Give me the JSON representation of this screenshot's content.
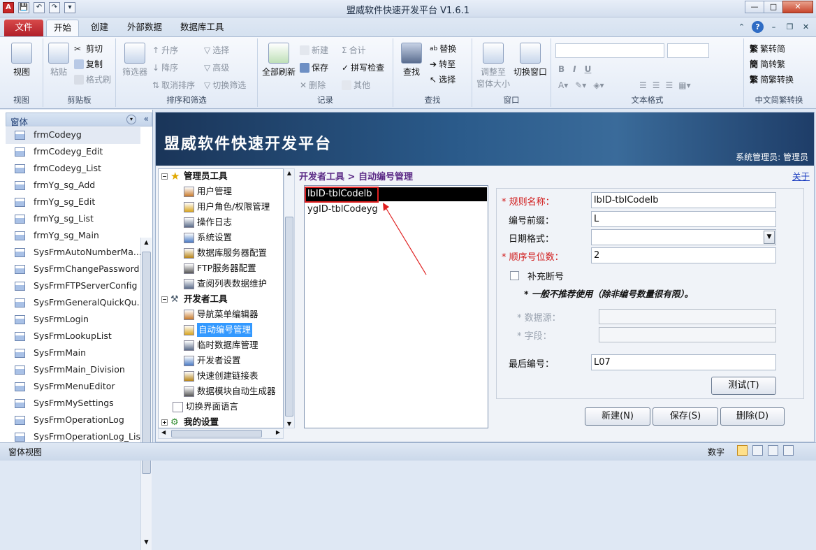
{
  "window": {
    "title": "盟威软件快速开发平台 V1.6.1",
    "app_icon": "A"
  },
  "qat": {
    "save_icon": "💾",
    "undo_icon": "↶",
    "redo_icon": "↷",
    "more_icon": "▾"
  },
  "tabs": [
    "文件",
    "开始",
    "创建",
    "外部数据",
    "数据库工具"
  ],
  "ribbon": {
    "view": {
      "view": "视图",
      "group": "视图"
    },
    "clipboard": {
      "paste": "粘贴",
      "cut": "剪切",
      "copy": "复制",
      "format_painter": "格式刷",
      "group": "剪贴板"
    },
    "sort": {
      "filter": "筛选器",
      "asc": "升序",
      "desc": "降序",
      "clear_sort": "取消排序",
      "select": "选择",
      "advanced": "高级",
      "toggle_filter": "切换筛选",
      "group": "排序和筛选"
    },
    "records": {
      "refresh_all": "全部刷新",
      "new": "新建",
      "save": "保存",
      "delete": "删除",
      "totals": "合计",
      "spelling": "拼写检查",
      "more": "其他",
      "group": "记录"
    },
    "find": {
      "find": "查找",
      "replace": "替换",
      "goto": "转至",
      "select": "选择",
      "group": "查找"
    },
    "window": {
      "size_to_fit": "调整至",
      "size_to_fit2": "窗体大小",
      "switch_windows": "切换窗口",
      "group": "窗口"
    },
    "text_format": {
      "bold": "B",
      "italic": "I",
      "underline": "U",
      "group": "文本格式"
    },
    "convert": {
      "t2s": "繁转简",
      "s2t": "简转繁",
      "s2t_alt": "简繁转换",
      "group": "中文简繁转换"
    }
  },
  "nav": {
    "header": "窗体",
    "items": [
      "frmCodeyg",
      "frmCodeyg_Edit",
      "frmCodeyg_List",
      "frmYg_sg_Add",
      "frmYg_sg_Edit",
      "frmYg_sg_List",
      "frmYg_sg_Main",
      "SysFrmAutoNumberMa...",
      "SysFrmChangePassword",
      "SysFrmFTPServerConfig",
      "SysFrmGeneralQuickQu...",
      "SysFrmLogin",
      "SysFrmLookupList",
      "SysFrmMain",
      "SysFrmMain_Division",
      "SysFrmMenuEditor",
      "SysFrmMySettings",
      "SysFrmOperationLog",
      "SysFrmOperationLog_List"
    ]
  },
  "banner": {
    "title": "盟威软件快速开发平台",
    "user": "系统管理员: 管理员"
  },
  "tree": {
    "admin": "管理员工具",
    "admin_items": [
      "用户管理",
      "用户角色/权限管理",
      "操作日志",
      "系统设置",
      "数据库服务器配置",
      "FTP服务器配置",
      "查阅列表数据维护"
    ],
    "dev": "开发者工具",
    "dev_items": [
      "导航菜单编辑器",
      "自动编号管理",
      "临时数据库管理",
      "开发者设置",
      "快速创建链接表",
      "数据模块自动生成器"
    ],
    "lang": "切换界面语言",
    "mysettings": "我的设置"
  },
  "breadcrumb": "开发者工具 > 自动编号管理",
  "close": "关于",
  "rules": [
    "lbID-tblCodelb",
    "ygID-tblCodeyg"
  ],
  "detail": {
    "rule_name_label": "规则名称：",
    "rule_name": "lbID-tblCodelb",
    "prefix_label": "编号前缀：",
    "prefix": "L",
    "date_label": "日期格式：",
    "date": "",
    "seq_label": "顺序号位数：",
    "seq": "2",
    "fill_label": "补充断号",
    "note": "* 一般不推荐使用（除非编号数量很有限）。",
    "datasource_label": "* 数据源：",
    "field_label": "* 字段：",
    "last_label": "最后编号：",
    "last": "L07",
    "test": "测试(T)"
  },
  "buttons": {
    "new": "新建(N)",
    "save": "保存(S)",
    "delete": "删除(D)"
  },
  "status": {
    "left": "窗体视图",
    "numlock": "数字"
  }
}
